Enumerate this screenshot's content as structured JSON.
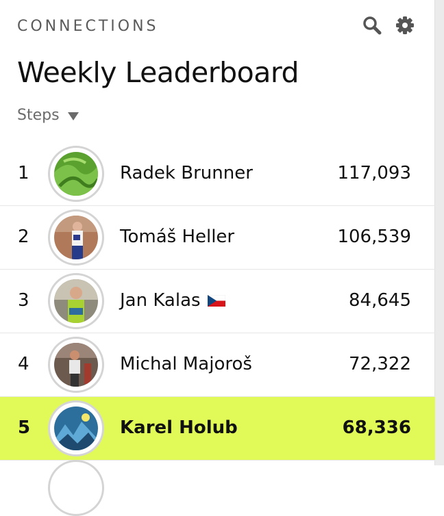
{
  "header": {
    "section_label": "CONNECTIONS",
    "title": "Weekly Leaderboard",
    "search_icon": "search-icon",
    "settings_icon": "gear-icon"
  },
  "metric": {
    "selected": "Steps"
  },
  "leaderboard": [
    {
      "rank": "1",
      "name": "Radek Brunner",
      "steps": "117,093",
      "flag": null,
      "highlight": false
    },
    {
      "rank": "2",
      "name": "Tomáš Heller",
      "steps": "106,539",
      "flag": null,
      "highlight": false
    },
    {
      "rank": "3",
      "name": "Jan Kalas",
      "steps": "84,645",
      "flag": "czech-flag",
      "highlight": false
    },
    {
      "rank": "4",
      "name": "Michal Majoroš",
      "steps": "72,322",
      "flag": null,
      "highlight": false
    },
    {
      "rank": "5",
      "name": "Karel Holub",
      "steps": "68,336",
      "flag": null,
      "highlight": true
    }
  ],
  "colors": {
    "highlight": "#e2fa57",
    "text": "#111111",
    "muted": "#5a5a5a"
  }
}
